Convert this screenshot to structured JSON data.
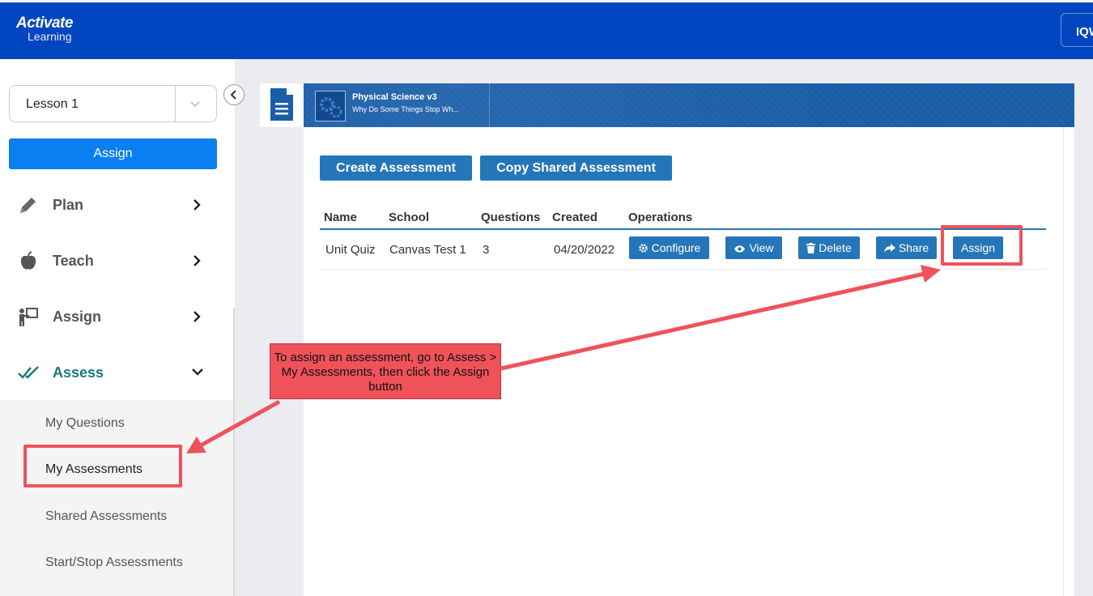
{
  "header": {
    "logo_line1": "Activate",
    "logo_line2": "Learning",
    "user_label": "IQW"
  },
  "sidebar": {
    "lesson_select": {
      "value": "Lesson 1"
    },
    "assign_button": "Assign",
    "nav": [
      {
        "label": "Plan",
        "icon": "pencil-icon"
      },
      {
        "label": "Teach",
        "icon": "apple-icon"
      },
      {
        "label": "Assign",
        "icon": "presenter-icon"
      },
      {
        "label": "Assess",
        "icon": "double-check-icon"
      }
    ],
    "assess_submenu": [
      {
        "label": "My Questions"
      },
      {
        "label": "My Assessments"
      },
      {
        "label": "Shared Assessments"
      },
      {
        "label": "Start/Stop Assessments"
      }
    ]
  },
  "banner": {
    "course_title": "Physical Science v3",
    "unit_title": "Why Do Some Things Stop Wh..."
  },
  "toolbar": {
    "create_label": "Create Assessment",
    "copy_shared_label": "Copy Shared Assessment"
  },
  "table": {
    "columns": [
      "Name",
      "School",
      "Questions",
      "Created",
      "Operations"
    ],
    "rows": [
      {
        "name": "Unit Quiz",
        "school": "Canvas Test 1",
        "questions": "3",
        "created": "04/20/2022",
        "operations": {
          "configure": "Configure",
          "view": "View",
          "delete": "Delete",
          "share": "Share",
          "assign": "Assign"
        }
      }
    ]
  },
  "annotation": {
    "text": "To assign an assessment, go to Assess > My Assessments, then click the Assign button",
    "color": "#f0525a"
  },
  "colors": {
    "brand_blue": "#0046c0",
    "button_blue": "#2576b8",
    "primary_blue": "#0a7ff0",
    "active_teal": "#1a7a7e"
  }
}
